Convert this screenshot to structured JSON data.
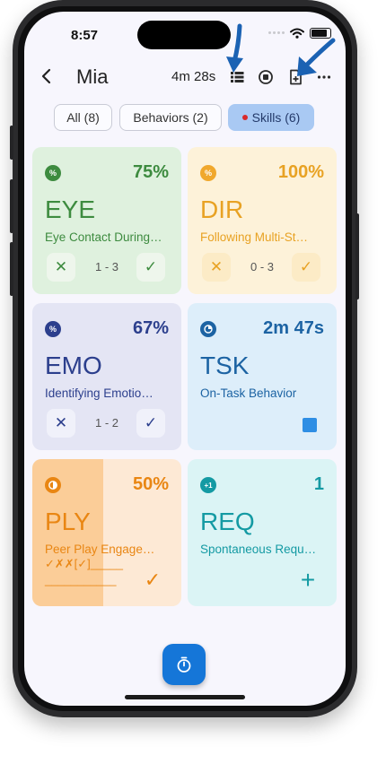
{
  "status": {
    "time": "8:57"
  },
  "header": {
    "title": "Mia",
    "timer": "4m 28s"
  },
  "tabs": [
    {
      "label": "All (8)"
    },
    {
      "label": "Behaviors (2)"
    },
    {
      "label": "Skills (6)"
    }
  ],
  "cards": [
    {
      "code": "EYE",
      "desc": "Eye Contact During…",
      "value": "75%",
      "count": "1 - 3",
      "colors": {
        "bg": "#dff1de",
        "accent": "#3d8b3f"
      }
    },
    {
      "code": "DIR",
      "desc": "Following Multi-St…",
      "value": "100%",
      "count": "0 - 3",
      "colors": {
        "bg": "#fdf2d9",
        "accent": "#e8a223"
      }
    },
    {
      "code": "EMO",
      "desc": "Identifying Emotio…",
      "value": "67%",
      "count": "1 - 2",
      "colors": {
        "bg": "#e4e5f4",
        "accent": "#2c3f8d"
      }
    },
    {
      "code": "TSK",
      "desc": "On-Task Behavior",
      "value": "2m 47s",
      "colors": {
        "bg": "#ddeefa",
        "accent": "#1c63a3"
      }
    },
    {
      "code": "PLY",
      "desc": "Peer Play Engage…",
      "value": "50%",
      "trials": "✓✗✗[✓]_____",
      "trials2": "___________",
      "colors": {
        "bg": "#fde9d5",
        "accent": "#e98613"
      }
    },
    {
      "code": "REQ",
      "desc": "Spontaneous Requ…",
      "value": "1",
      "colors": {
        "bg": "#dbf4f5",
        "accent": "#149aa3"
      }
    }
  ],
  "icons": {
    "back": "chevron-left-icon",
    "list": "list-icon",
    "stop": "stop-circle-icon",
    "add_note": "file-plus-icon",
    "more": "more-horizontal-icon",
    "timer": "stopwatch-icon"
  }
}
